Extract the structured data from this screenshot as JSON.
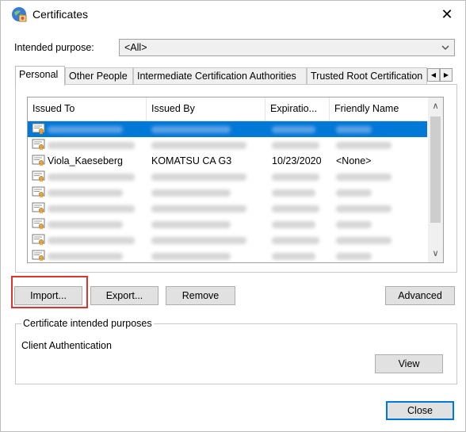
{
  "window": {
    "title": "Certificates",
    "close_glyph": "✕",
    "icon": "certificate-app-icon"
  },
  "intended_purpose": {
    "label": "Intended purpose:",
    "value": "<All>"
  },
  "tabs": [
    {
      "label": "Personal",
      "active": true
    },
    {
      "label": "Other People",
      "active": false
    },
    {
      "label": "Intermediate Certification Authorities",
      "active": false
    },
    {
      "label": "Trusted Root Certification",
      "active": false
    }
  ],
  "tab_scroll": {
    "left": "◀",
    "right": "▶"
  },
  "columns": [
    "Issued To",
    "Issued By",
    "Expiratio...",
    "Friendly Name"
  ],
  "rows": [
    {
      "issued_to": "",
      "issued_by": "",
      "expiration": "",
      "friendly_name": "",
      "selected": true,
      "redacted": true
    },
    {
      "issued_to": "",
      "issued_by": "",
      "expiration": "",
      "friendly_name": "",
      "selected": false,
      "redacted": true
    },
    {
      "issued_to": "Viola_Kaeseberg",
      "issued_by": "KOMATSU CA G3",
      "expiration": "10/23/2020",
      "friendly_name": "<None>",
      "selected": false,
      "redacted": false
    },
    {
      "issued_to": "",
      "issued_by": "",
      "expiration": "",
      "friendly_name": "",
      "selected": false,
      "redacted": true
    },
    {
      "issued_to": "",
      "issued_by": "",
      "expiration": "",
      "friendly_name": "",
      "selected": false,
      "redacted": true
    },
    {
      "issued_to": "",
      "issued_by": "",
      "expiration": "",
      "friendly_name": "",
      "selected": false,
      "redacted": true
    },
    {
      "issued_to": "",
      "issued_by": "",
      "expiration": "",
      "friendly_name": "",
      "selected": false,
      "redacted": true
    },
    {
      "issued_to": "",
      "issued_by": "",
      "expiration": "",
      "friendly_name": "",
      "selected": false,
      "redacted": true
    },
    {
      "issued_to": "",
      "issued_by": "",
      "expiration": "",
      "friendly_name": "",
      "selected": false,
      "redacted": true
    }
  ],
  "scrollbar": {
    "up": "∧",
    "down": "∨"
  },
  "buttons": {
    "import": "Import...",
    "export": "Export...",
    "remove": "Remove",
    "advanced": "Advanced",
    "view": "View",
    "close": "Close"
  },
  "purposes": {
    "title": "Certificate intended purposes",
    "value": "Client Authentication"
  },
  "colors": {
    "selection": "#0078d7",
    "highlight_box": "#e0322f",
    "default_button_border": "#0078d7"
  }
}
